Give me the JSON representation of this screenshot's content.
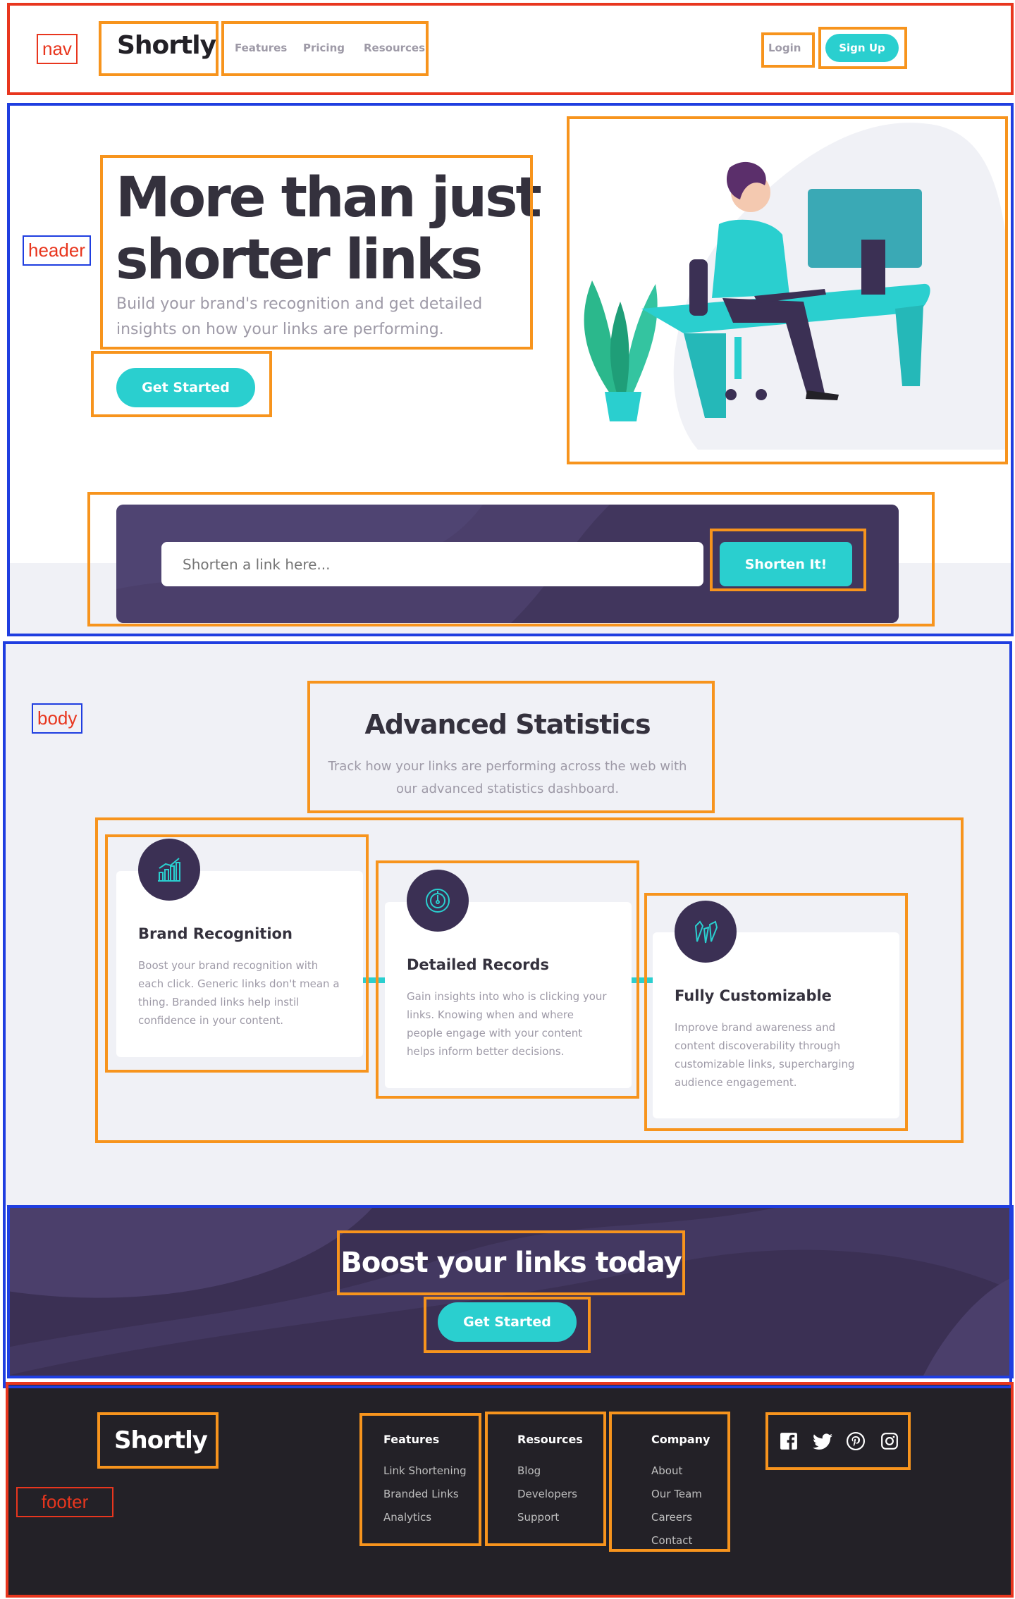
{
  "annotations": {
    "nav": "nav",
    "header": "header",
    "body": "body",
    "footer": "footer"
  },
  "nav": {
    "logo": "Shortly",
    "links": [
      "Features",
      "Pricing",
      "Resources"
    ],
    "login": "Login",
    "signup": "Sign Up"
  },
  "hero": {
    "title_line1": "More than just",
    "title_line2": "shorter links",
    "subtitle_line1": "Build your brand's recognition and get detailed",
    "subtitle_line2": "insights on how your links are performing.",
    "cta": "Get Started"
  },
  "shorten": {
    "placeholder": "Shorten a link here...",
    "button": "Shorten It!"
  },
  "stats": {
    "title": "Advanced Statistics",
    "subtitle_line1": "Track how your links are performing across the web with",
    "subtitle_line2": "our advanced statistics dashboard.",
    "cards": [
      {
        "icon": "brand-recognition-icon",
        "title": "Brand Recognition",
        "lines": [
          "Boost your brand recognition with",
          "each click. Generic links don't mean a",
          "thing. Branded links help instil",
          "confidence in your content."
        ]
      },
      {
        "icon": "detailed-records-icon",
        "title": "Detailed Records",
        "lines": [
          "Gain insights into who is clicking your",
          "links. Knowing when and where",
          "people engage with your content",
          "helps inform better decisions."
        ]
      },
      {
        "icon": "fully-customizable-icon",
        "title": "Fully Customizable",
        "lines": [
          "Improve brand awareness and",
          "content discoverability through",
          "customizable links, supercharging",
          "audience engagement."
        ]
      }
    ]
  },
  "boost": {
    "title": "Boost your links today",
    "cta": "Get Started"
  },
  "footer": {
    "logo": "Shortly",
    "columns": [
      {
        "heading": "Features",
        "links": [
          "Link Shortening",
          "Branded Links",
          "Analytics"
        ]
      },
      {
        "heading": "Resources",
        "links": [
          "Blog",
          "Developers",
          "Support"
        ]
      },
      {
        "heading": "Company",
        "links": [
          "About",
          "Our Team",
          "Careers",
          "Contact"
        ]
      }
    ],
    "social": [
      "facebook-icon",
      "twitter-icon",
      "pinterest-icon",
      "instagram-icon"
    ]
  },
  "colors": {
    "cyan": "#2acfcf",
    "dark_violet": "#3b3054",
    "very_dark": "#232127",
    "gray": "#9e9aa7",
    "annotation_orange": "#f7941d",
    "annotation_red": "#e8361e",
    "annotation_blue": "#1f3ee0"
  }
}
